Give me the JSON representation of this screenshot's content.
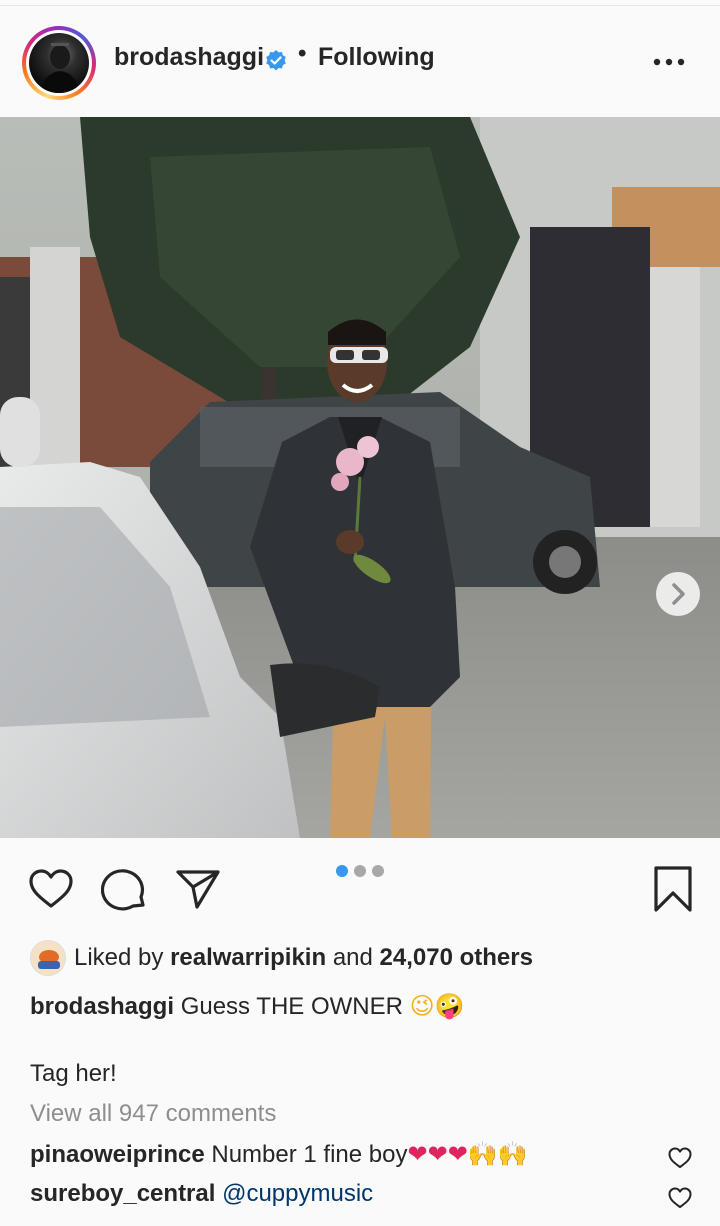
{
  "post": {
    "username": "brodashaggi",
    "separator": "•",
    "follow_status": "Following",
    "verified": true
  },
  "likes": {
    "prefix": "Liked by",
    "liker": "realwarripikin",
    "and": "and",
    "others": "24,070 others"
  },
  "caption": {
    "username": "brodashaggi",
    "text": "Guess THE OWNER",
    "emojis": "😉🤪",
    "line2": "Tag her!"
  },
  "view_all": "View all 947 comments",
  "comments": [
    {
      "username": "pinaoweiprince",
      "text": "Number 1 fine boy",
      "emojis": "❤❤❤🙌🙌"
    },
    {
      "username": "sureboy_central",
      "mention": "@cuppymusic"
    }
  ],
  "carousel": {
    "total": 3,
    "current": 1
  },
  "colors": {
    "accent_blue": "#3897f0",
    "text": "#262626",
    "muted": "#8e8e8e",
    "mention": "#00376b",
    "background": "#fafafa"
  },
  "icons": [
    "verified-badge-icon",
    "more-options-icon",
    "heart-icon",
    "comment-icon",
    "share-icon",
    "bookmark-icon",
    "chevron-right-icon"
  ]
}
